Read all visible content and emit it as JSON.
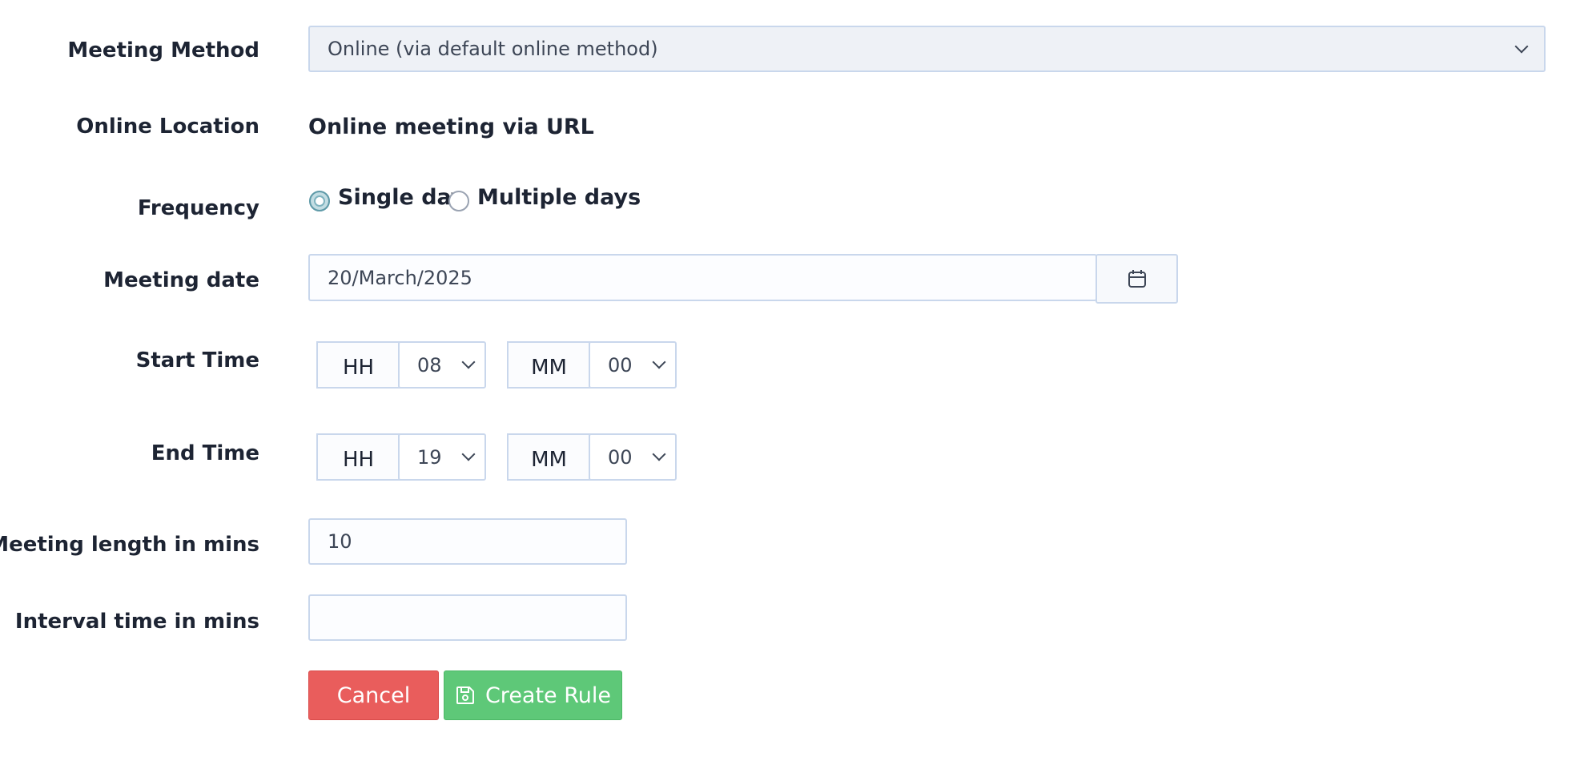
{
  "form": {
    "meeting_method": {
      "label": "Meeting Method",
      "value": "Online (via default online method)"
    },
    "online_location": {
      "label": "Online Location",
      "value": "Online meeting via URL"
    },
    "frequency": {
      "label": "Frequency",
      "options": [
        {
          "label": "Single day",
          "selected": true
        },
        {
          "label": "Multiple days",
          "selected": false
        }
      ]
    },
    "meeting_date": {
      "label": "Meeting date",
      "value": "20/March/2025",
      "calendar_icon": "calendar-icon"
    },
    "start_time": {
      "label": "Start Time",
      "hour_addon": "HH",
      "hour_value": "08",
      "minute_addon": "MM",
      "minute_value": "00"
    },
    "end_time": {
      "label": "End Time",
      "hour_addon": "HH",
      "hour_value": "19",
      "minute_addon": "MM",
      "minute_value": "00"
    },
    "meeting_length": {
      "label": "Meeting length in mins",
      "value": "10"
    },
    "interval_time": {
      "label": "Interval time in mins",
      "value": ""
    }
  },
  "buttons": {
    "cancel_label": "Cancel",
    "create_label": "Create Rule",
    "create_icon": "save-icon"
  },
  "colors": {
    "cancel": "#e95d5c",
    "create": "#5ec878",
    "radio_selected": "#7fb3bf",
    "border": "#c9d7ec"
  }
}
